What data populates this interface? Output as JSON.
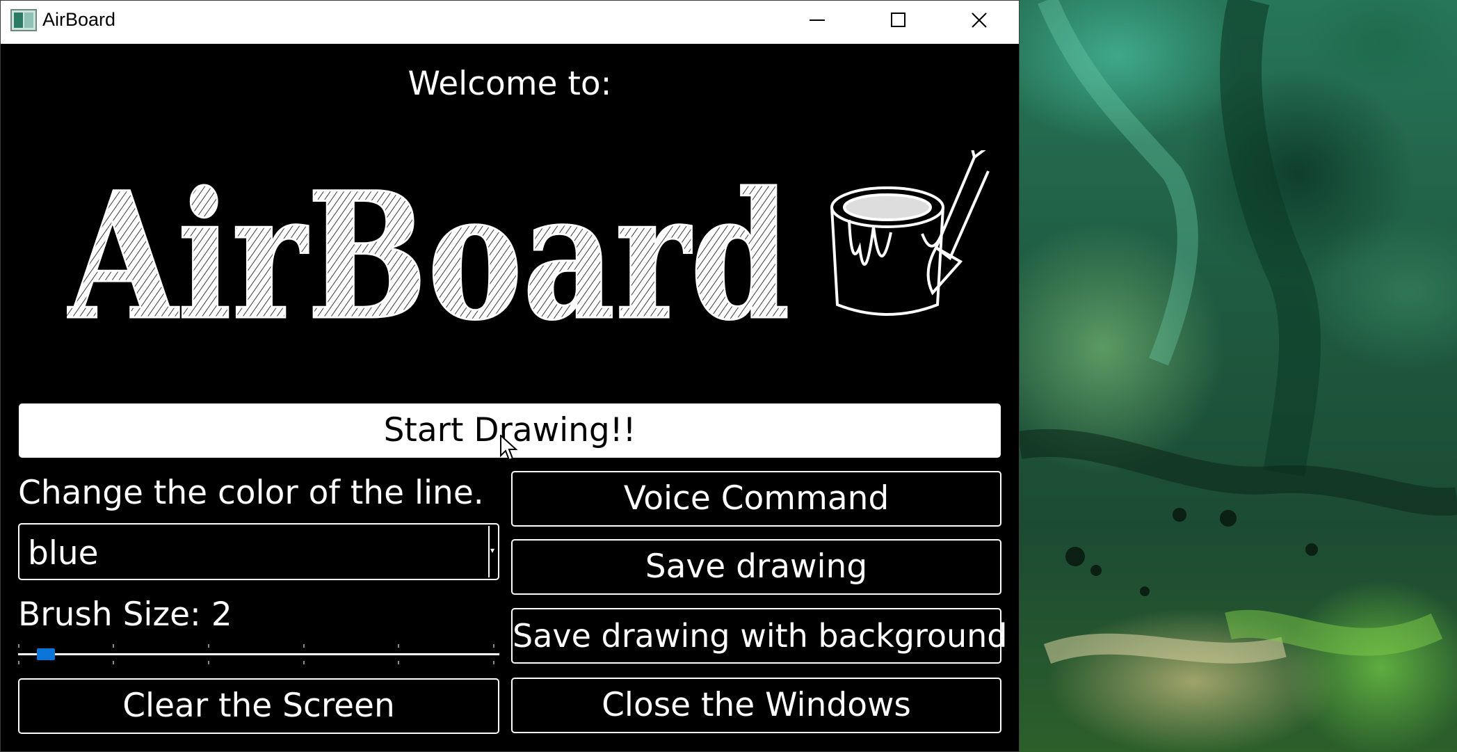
{
  "window": {
    "title": "AirBoard",
    "controls": [
      "minimize",
      "maximize",
      "close"
    ]
  },
  "main": {
    "welcome_text": "Welcome to:",
    "logo_text": "AirBoard",
    "start_button": "Start Drawing!!",
    "color_label": "Change the color of the line.",
    "color_select_value": "blue",
    "brush_label": "Brush Size: 2",
    "brush_size": 2,
    "brush_slider_fraction": 0.02,
    "clear_button": "Clear the Screen",
    "voice_button": "Voice Command",
    "save_button": "Save drawing",
    "save_bg_button": "Save drawing with background",
    "close_button": "Close the Windows"
  },
  "colors": {
    "window_bg": "#000000",
    "titlebar_bg": "#ffffff",
    "slider_thumb": "#0a74d8",
    "text": "#ffffff"
  },
  "icons": {
    "app": "airboard-app-icon",
    "cursor": "mouse-pointer-icon"
  }
}
